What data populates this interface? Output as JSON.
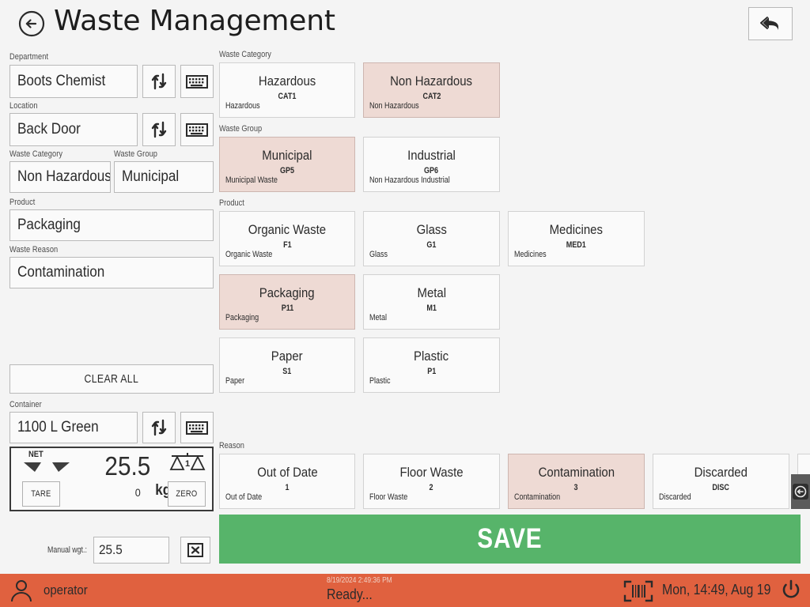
{
  "header": {
    "title": "Waste Management",
    "back_icon": "circle-arrow-left-icon",
    "undo_icon": "undo-arrow-icon"
  },
  "form": {
    "department": {
      "label": "Department",
      "value": "Boots Chemist"
    },
    "location": {
      "label": "Location",
      "value": "Back Door"
    },
    "waste_category": {
      "label": "Waste Category",
      "value": "Non Hazardous"
    },
    "waste_group": {
      "label": "Waste Group",
      "value": "Municipal"
    },
    "product": {
      "label": "Product",
      "value": "Packaging"
    },
    "waste_reason": {
      "label": "Waste Reason",
      "value": "Contamination"
    },
    "container": {
      "label": "Container",
      "value": "1100 L  Green"
    },
    "clear_all_label": "CLEAR ALL",
    "swap_icon": "swap-arrows-icon",
    "keyboard_icon": "keyboard-icon"
  },
  "scale": {
    "net_label": "NET",
    "weight": "25.5",
    "secondary": "0",
    "unit": "kg",
    "tare_label": "TARE",
    "zero_label": "ZERO",
    "balance_icon": "balance-scale-icon",
    "balance_range": "1"
  },
  "manual_weight": {
    "label": "Manual wgt.:",
    "value": "25.5",
    "clear_icon": "x-box-icon"
  },
  "sections": {
    "waste_category": {
      "label": "Waste Category",
      "tiles": [
        {
          "name": "Hazardous",
          "code": "CAT1",
          "desc": "Hazardous",
          "selected": false
        },
        {
          "name": "Non Hazardous",
          "code": "CAT2",
          "desc": "Non Hazardous",
          "selected": true
        }
      ]
    },
    "waste_group": {
      "label": "Waste Group",
      "tiles": [
        {
          "name": "Municipal",
          "code": "GP5",
          "desc": "Municipal Waste",
          "selected": true
        },
        {
          "name": "Industrial",
          "code": "GP6",
          "desc": "Non Hazardous Industrial",
          "selected": false
        }
      ]
    },
    "product": {
      "label": "Product",
      "tiles": [
        {
          "name": "Organic Waste",
          "code": "F1",
          "desc": "Organic Waste",
          "selected": false
        },
        {
          "name": "Glass",
          "code": "G1",
          "desc": "Glass",
          "selected": false
        },
        {
          "name": "Medicines",
          "code": "MED1",
          "desc": "Medicines",
          "selected": false
        },
        {
          "name": "Packaging",
          "code": "P11",
          "desc": "Packaging",
          "selected": true
        },
        {
          "name": "Metal",
          "code": "M1",
          "desc": "Metal",
          "selected": false
        },
        {
          "name": "Paper",
          "code": "S1",
          "desc": "Paper",
          "selected": false
        },
        {
          "name": "Plastic",
          "code": "P1",
          "desc": "Plastic",
          "selected": false
        }
      ]
    },
    "reason": {
      "label": "Reason",
      "tiles": [
        {
          "name": "Out of Date",
          "code": "1",
          "desc": "Out of Date",
          "selected": false
        },
        {
          "name": "Floor Waste",
          "code": "2",
          "desc": "Floor Waste",
          "selected": false
        },
        {
          "name": "Contamination",
          "code": "3",
          "desc": "Contamination",
          "selected": true
        },
        {
          "name": "Discarded",
          "code": "DISC",
          "desc": "Discarded",
          "selected": false
        }
      ]
    }
  },
  "save": {
    "label": "SAVE"
  },
  "drawer": {
    "icon": "arrow-left-circle-icon"
  },
  "statusbar": {
    "user_icon": "user-icon",
    "user": "operator",
    "timestamp": "8/19/2024 2:49:36 PM",
    "message": "Ready...",
    "barcode_icon": "barcode-scanner-icon",
    "clock": "Mon, 14:49, Aug 19",
    "power_icon": "power-icon"
  },
  "colors": {
    "accent_selected": "#eedad4",
    "save_green": "#57b46a",
    "statusbar": "#e0613f",
    "background": "#f4f4f4"
  }
}
